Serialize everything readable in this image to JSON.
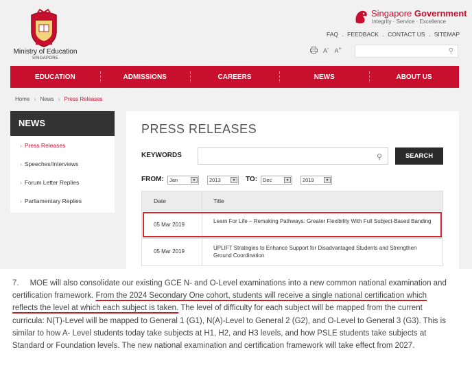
{
  "header": {
    "ministry_name": "Ministry of Education",
    "ministry_sub": "SINGAPORE",
    "gov_title_prefix": "Singapore ",
    "gov_title_bold": "Government",
    "gov_tagline": "Integrity · Service · Excellence",
    "links": [
      "FAQ",
      "FEEDBACK",
      "CONTACT US",
      "SITEMAP"
    ],
    "link_separator": ".",
    "text_small": "A",
    "text_minus": "-",
    "text_large": "A",
    "text_plus": "+",
    "search_placeholder": ""
  },
  "nav": {
    "items": [
      "EDUCATION",
      "ADMISSIONS",
      "CAREERS",
      "NEWS",
      "ABOUT US"
    ]
  },
  "breadcrumb": {
    "home": "Home",
    "news": "News",
    "current": "Press Releases",
    "separator": "›"
  },
  "sidebar": {
    "heading": "NEWS",
    "items": [
      "Press Releases",
      "Speeches/Interviews",
      "Forum Letter Replies",
      "Parliamentary Replies"
    ],
    "active_index": 0
  },
  "main": {
    "title": "PRESS RELEASES",
    "keywords_label": "KEYWORDS",
    "keywords_value": "",
    "search_button": "SEARCH",
    "from_label": "FROM:",
    "from_month": "Jan",
    "from_year": "2013",
    "to_label": "TO:",
    "to_month": "Dec",
    "to_year": "2019",
    "table": {
      "headers": [
        "Date",
        "Title"
      ],
      "rows": [
        {
          "date": "05 Mar 2019",
          "title": "Learn For Life – Remaking Pathways: Greater Flexibility With Full Subject-Based Banding"
        },
        {
          "date": "05 Mar 2019",
          "title": "UPLIFT Strategies to Enhance Support for Disadvantaged Students and Strengthen Ground Coordination"
        }
      ]
    }
  },
  "article": {
    "number": "7.",
    "part1": "MOE will also consolidate our existing GCE N- and O-Level examinations into a new common national examination and certification framework. ",
    "highlight": "From the 2024 Secondary One cohort, students will receive a single national certification which reflects the level at which each subject is taken.",
    "part2": " The level of difficulty for each subject will be mapped from the current curricula: N(T)-Level will be mapped to General 1 (G1), N(A)-Level to General 2 (G2), and O-Level to General 3 (G3). This is similar to how A- Level students today take subjects at H1, H2, and H3 levels, and how PSLE students take subjects at Standard or Foundation levels. The new national examination and certification framework will take effect from 2027."
  },
  "colors": {
    "brand_red": "#c8102e",
    "highlight_red": "#d7262e",
    "dark": "#2b2b2b"
  },
  "icons": {
    "crest": "moe-crest-icon",
    "lion": "lion-head-icon",
    "print": "print-icon",
    "search": "search-icon",
    "dropdown": "dropdown-arrow-icon",
    "chevron": "chevron-right-icon"
  }
}
